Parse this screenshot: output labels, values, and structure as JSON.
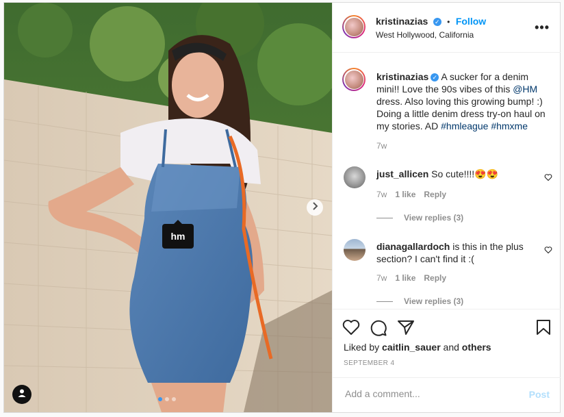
{
  "post": {
    "tag_label": "hm",
    "carousel": {
      "count": 3,
      "active": 1
    }
  },
  "header": {
    "username": "kristinazias",
    "verified_mark": "✓",
    "separator": "•",
    "follow_label": "Follow",
    "location": "West Hollywood, California",
    "more_label": "•••"
  },
  "caption": {
    "username": "kristinazias",
    "text_a": "A sucker for a denim mini!! Love the 90s vibes of this ",
    "mention": "@HM",
    "text_b": " dress. Also loving this growing bump! :) Doing a little denim dress try-on haul on my stories. AD ",
    "hashtag1": "#hmleague",
    "hashtag2": "#hmxme",
    "age": "7w"
  },
  "comments": [
    {
      "username": "just_allicen",
      "text": "So cute!!!!😍😍",
      "age": "7w",
      "likes": "1 like",
      "reply": "Reply",
      "view_replies": "View replies (3)"
    },
    {
      "username": "dianagallardoch",
      "text": "is this in the plus section? I can't find it :(",
      "age": "7w",
      "likes": "1 like",
      "reply": "Reply",
      "view_replies": "View replies (3)"
    }
  ],
  "likes": {
    "prefix": "Liked by ",
    "user": "caitlin_sauer",
    "and": " and ",
    "others": "others"
  },
  "date": "SEPTEMBER 4",
  "comment_box": {
    "placeholder": "Add a comment...",
    "post_label": "Post"
  },
  "icons": [
    "heart-icon",
    "comment-icon",
    "share-icon",
    "bookmark-icon",
    "user-tags-icon",
    "chevron-right-icon",
    "more-icon"
  ],
  "colors": {
    "link": "#00376b",
    "follow": "#0095f6",
    "muted": "#8e8e8e"
  }
}
